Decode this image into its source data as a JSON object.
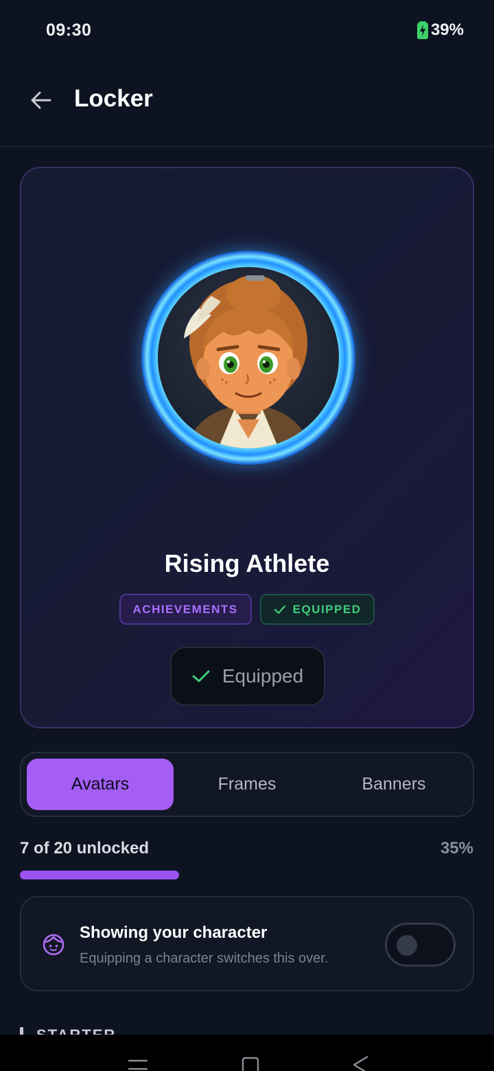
{
  "status_bar": {
    "time": "09:30",
    "battery": "39%"
  },
  "app_bar": {
    "title": "Locker"
  },
  "hero": {
    "name": "Rising Athlete",
    "badges": {
      "category": "ACHIEVEMENTS",
      "state": "EQUIPPED"
    },
    "action_label": "Equipped",
    "accent_color": "#a45ef4",
    "success_color": "#3ecf7c"
  },
  "tabs": [
    {
      "label": "Avatars",
      "active": true
    },
    {
      "label": "Frames",
      "active": false
    },
    {
      "label": "Banners",
      "active": false
    }
  ],
  "progress": {
    "label": "7 of 20 unlocked",
    "percent_label": "35%",
    "fraction": 0.35
  },
  "character_toggle": {
    "title": "Showing your character",
    "subtitle": "Equipping a character switches this over.",
    "enabled": false
  },
  "section": {
    "title": "STARTER"
  },
  "icons": {
    "back": "arrow-left-icon",
    "battery": "battery-charging-icon",
    "check": "check-icon",
    "face": "face-icon",
    "nav": [
      "menu-icon",
      "home-square-icon",
      "back-triangle-icon"
    ]
  }
}
